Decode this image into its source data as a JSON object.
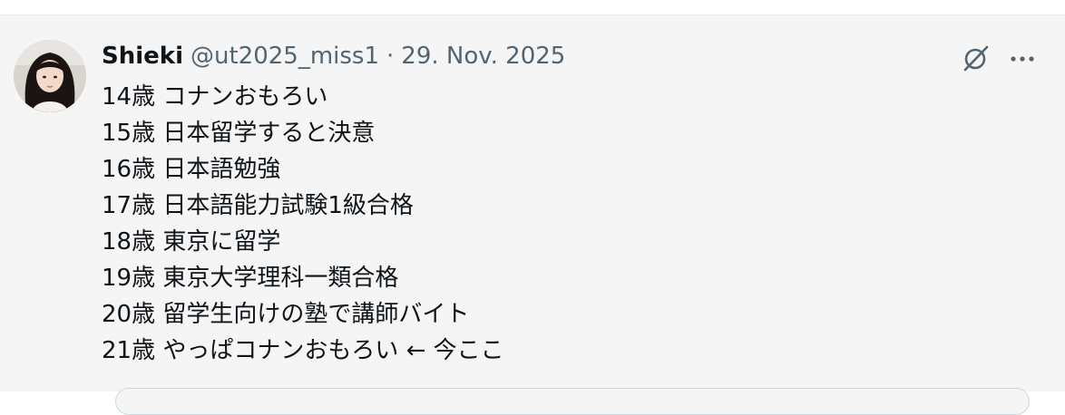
{
  "post": {
    "author": {
      "display_name": "Shieki",
      "handle": "@ut2025_miss1",
      "separator": "·",
      "date": "29. Nov. 2025"
    },
    "lines": [
      "14歳 コナンおもろい",
      "15歳 日本留学すると決意",
      "16歳 日本語勉強",
      "17歳 日本語能力試験1級合格",
      "18歳 東京に留学",
      "19歳 東京大学理科一類合格",
      "20歳 留学生向けの塾で講師バイト",
      "21歳 やっぱコナンおもろい ← 今ここ"
    ],
    "icons": {
      "grok": "grok-icon",
      "more": "more-icon",
      "avatar": "avatar"
    }
  },
  "colors": {
    "background": "#f5f5f5",
    "text_primary": "#0f1419",
    "text_secondary": "#536471",
    "border": "#cfd9de"
  }
}
